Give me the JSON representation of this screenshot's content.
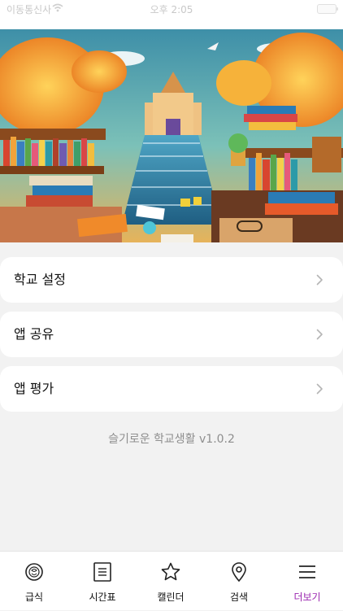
{
  "status_bar": {
    "carrier": "이동통신사",
    "time": "오후 2:05"
  },
  "menu": [
    {
      "label": "학교 설정"
    },
    {
      "label": "앱 공유"
    },
    {
      "label": "앱 평가"
    }
  ],
  "version": "슬기로운 학교생활 v1.0.2",
  "tabs": [
    {
      "label": "급식",
      "icon": "meal-icon"
    },
    {
      "label": "시간표",
      "icon": "timetable-icon"
    },
    {
      "label": "캘린더",
      "icon": "star-icon"
    },
    {
      "label": "검색",
      "icon": "location-pin-icon"
    },
    {
      "label": "더보기",
      "icon": "menu-icon"
    }
  ],
  "colors": {
    "accent": "#9b27b0",
    "background": "#f2f2f2",
    "card": "#ffffff"
  }
}
